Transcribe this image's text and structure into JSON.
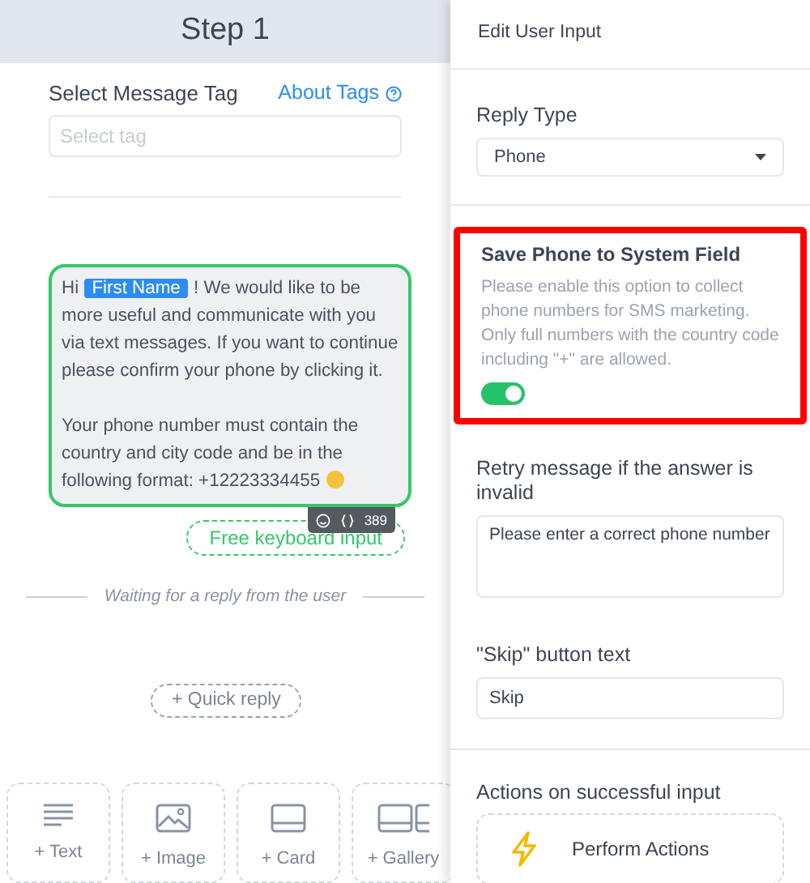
{
  "step_title": "Step 1",
  "message_tag": {
    "label": "Select Message Tag",
    "link": "About Tags",
    "placeholder": "Select tag"
  },
  "message": {
    "greeting": "Hi",
    "variable": "First Name",
    "paragraphs": [
      "! We would like to be more useful and communicate with you via text messages. If you want to continue please confirm your phone by clicking it.",
      "Your phone number must contain the country and city code and be in the following format: +12223334455"
    ],
    "char_count": "389",
    "selected": true
  },
  "free_input_button": "Free keyboard input",
  "waiting_text": "Waiting for a reply from the user",
  "quick_reply_button": "+ Quick reply",
  "add_blocks": [
    {
      "kind": "text",
      "label": "+ Text"
    },
    {
      "kind": "image",
      "label": "+ Image"
    },
    {
      "kind": "card",
      "label": "+ Card"
    },
    {
      "kind": "gallery",
      "label": "+ Gallery"
    }
  ],
  "panel": {
    "title": "Edit User Input",
    "reply_type": {
      "label": "Reply Type",
      "value": "Phone"
    },
    "save_phone": {
      "title": "Save Phone to System Field",
      "description": "Please enable this option to collect phone numbers for SMS marketing. Only full numbers with the country code including \"+\" are allowed.",
      "on": true,
      "highlighted": true
    },
    "retry": {
      "label": "Retry message if the answer is invalid",
      "value": "Please enter a correct phone number"
    },
    "skip": {
      "label": "\"Skip\" button text",
      "value": "Skip"
    },
    "actions": {
      "label": "Actions on successful input",
      "button": "Perform Actions"
    }
  }
}
